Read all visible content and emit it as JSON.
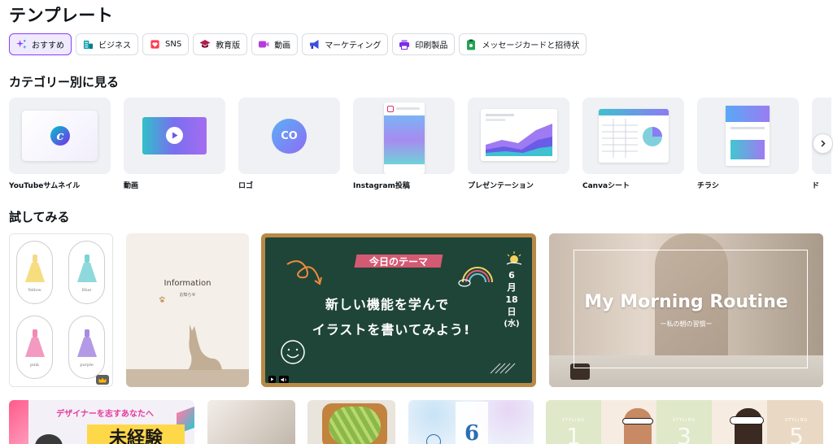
{
  "page_title": "テンプレート",
  "chips": [
    {
      "label": "おすすめ",
      "icon": "sparkle-icon",
      "color": "#8b3dff",
      "active": true
    },
    {
      "label": "ビジネス",
      "icon": "business-icon",
      "color": "#13a3b5"
    },
    {
      "label": "SNS",
      "icon": "heart-icon",
      "color": "#ff3b4b"
    },
    {
      "label": "教育版",
      "icon": "graduation-cap-icon",
      "color": "#b01e4e"
    },
    {
      "label": "動画",
      "icon": "video-icon",
      "color": "#b23ddb"
    },
    {
      "label": "マーケティング",
      "icon": "megaphone-icon",
      "color": "#3b4fe4"
    },
    {
      "label": "印刷製品",
      "icon": "printer-icon",
      "color": "#7d2ae8"
    },
    {
      "label": "メッセージカードと招待状",
      "icon": "card-icon",
      "color": "#23a455"
    }
  ],
  "sections": {
    "categories_title": "カテゴリー別に見る",
    "try_title": "試してみる"
  },
  "categories": [
    {
      "label": "YouTubeサムネイル"
    },
    {
      "label": "動画"
    },
    {
      "label": "ロゴ",
      "thumb_text": "CO"
    },
    {
      "label": "Instagram投稿"
    },
    {
      "label": "プレゼンテーション"
    },
    {
      "label": "Canvaシート"
    },
    {
      "label": "チラシ"
    },
    {
      "label": "ド"
    }
  ],
  "next_icon": "chevron-right-icon",
  "templates": {
    "dresses": {
      "names": [
        "Yellow",
        "Blue",
        "pink",
        "purple"
      ]
    },
    "info": {
      "title": "Information",
      "subtitle": "お知らせ"
    },
    "chalkboard": {
      "tag": "今日のテーマ",
      "line1": "新しい機能を学んで",
      "line2": "イラストを書いてみよう!",
      "date": [
        "6",
        "月",
        "18",
        "日",
        "(水)"
      ]
    },
    "morning": {
      "title": "My Morning Routine",
      "subtitle": "ー私の朝の習慣ー"
    }
  },
  "bottom": {
    "designer_text": "デザイナーを志すあなたへ",
    "designer_big": "未経験",
    "calendar_day": "6",
    "styling_label": "STYLING",
    "styling_numbers": [
      "1",
      "3",
      "5"
    ]
  }
}
